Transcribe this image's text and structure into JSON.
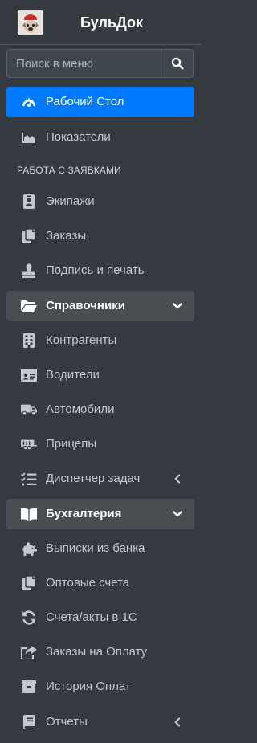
{
  "brand": {
    "title": "БульДок"
  },
  "search": {
    "placeholder": "Поиск в меню"
  },
  "nav": {
    "dashboard": "Рабочий Стол",
    "indicators": "Показатели",
    "section_header": "РАБОТА С ЗАЯВКАМИ",
    "crews": "Экипажи",
    "orders": "Заказы",
    "sign_stamp": "Подпись и печать",
    "directories": "Справочники",
    "counterparties": "Контрагенты",
    "drivers": "Водители",
    "cars": "Автомобили",
    "trailers": "Прицепы",
    "task_dispatcher": "Диспетчер задач",
    "accounting": "Бухгалтерия",
    "bank_statements": "Выписки из банка",
    "wholesale_invoices": "Оптовые счета",
    "invoices_1c": "Счета/акты в 1С",
    "orders_payment": "Заказы на Оплату",
    "payment_history": "История Оплат",
    "reports": "Отчеты"
  },
  "colors": {
    "sidebar_bg": "#343a40",
    "active_bg": "#007bff",
    "open_bg": "#494e53",
    "text": "#c2c7d0"
  },
  "icons": {
    "logo": "bulldog-logo",
    "search": "search-icon",
    "dashboard": "tachometer-icon",
    "indicators": "area-chart-icon",
    "crews": "id-badge-icon",
    "orders": "copy-icon",
    "sign_stamp": "stamp-icon",
    "directories": "folder-open-icon",
    "counterparties": "building-icon",
    "drivers": "id-card-icon",
    "cars": "truck-icon",
    "trailers": "trailer-icon",
    "task_dispatcher": "tasks-icon",
    "accounting": "book-open-icon",
    "bank_statements": "piggy-bank-icon",
    "wholesale_invoices": "copy-icon",
    "invoices_1c": "sync-icon",
    "orders_payment": "share-square-icon",
    "payment_history": "archive-icon",
    "reports": "book-icon"
  }
}
